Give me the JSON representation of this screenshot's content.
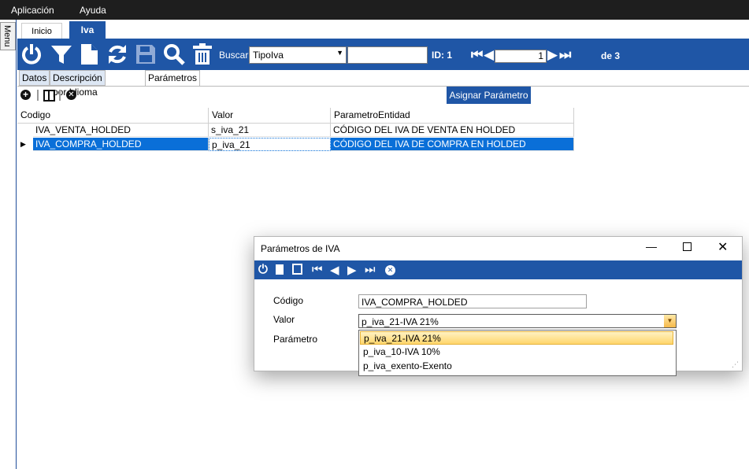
{
  "menubar": {
    "items": [
      "Aplicación",
      "Ayuda"
    ]
  },
  "side_menu_label": "Menu",
  "tabs": {
    "inicio": "Inicio",
    "iva": "Iva"
  },
  "toolbar": {
    "buscar_label": "Buscar",
    "buscar_combo_value": "TipoIva",
    "search_text": "",
    "id_label": "ID: 1",
    "record_number": "1",
    "total_label": "de 3",
    "icons": [
      "power-icon",
      "filter-icon",
      "new-document-icon",
      "refresh-icon",
      "save-icon",
      "search-icon",
      "delete-icon"
    ]
  },
  "subtabs": [
    "Datos",
    "Descripción por Idioma",
    "Parámetros"
  ],
  "grid_toolbar": {
    "assign_button": "Asignar Parámetro"
  },
  "grid": {
    "headers": [
      "Codigo",
      "Valor",
      "ParametroEntidad"
    ],
    "rows": [
      [
        "IVA_VENTA_HOLDED",
        "s_iva_21",
        "CÓDIGO DEL IVA DE VENTA EN HOLDED"
      ],
      [
        "IVA_COMPRA_HOLDED",
        "p_iva_21",
        "CÓDIGO DEL IVA DE COMPRA EN HOLDED"
      ]
    ]
  },
  "dialog": {
    "title": "Parámetros de IVA",
    "labels": {
      "codigo": "Código",
      "valor": "Valor",
      "parametro": "Parámetro"
    },
    "codigo_value": "IVA_COMPRA_HOLDED",
    "valor_value": "p_iva_21-IVA 21%",
    "options": [
      "p_iva_21-IVA 21%",
      "p_iva_10-IVA 10%",
      "p_iva_exento-Exento"
    ]
  },
  "colors": {
    "accent": "#1f56a6",
    "selected_row": "#0a6fd8",
    "menubar": "#1e1e1e"
  }
}
